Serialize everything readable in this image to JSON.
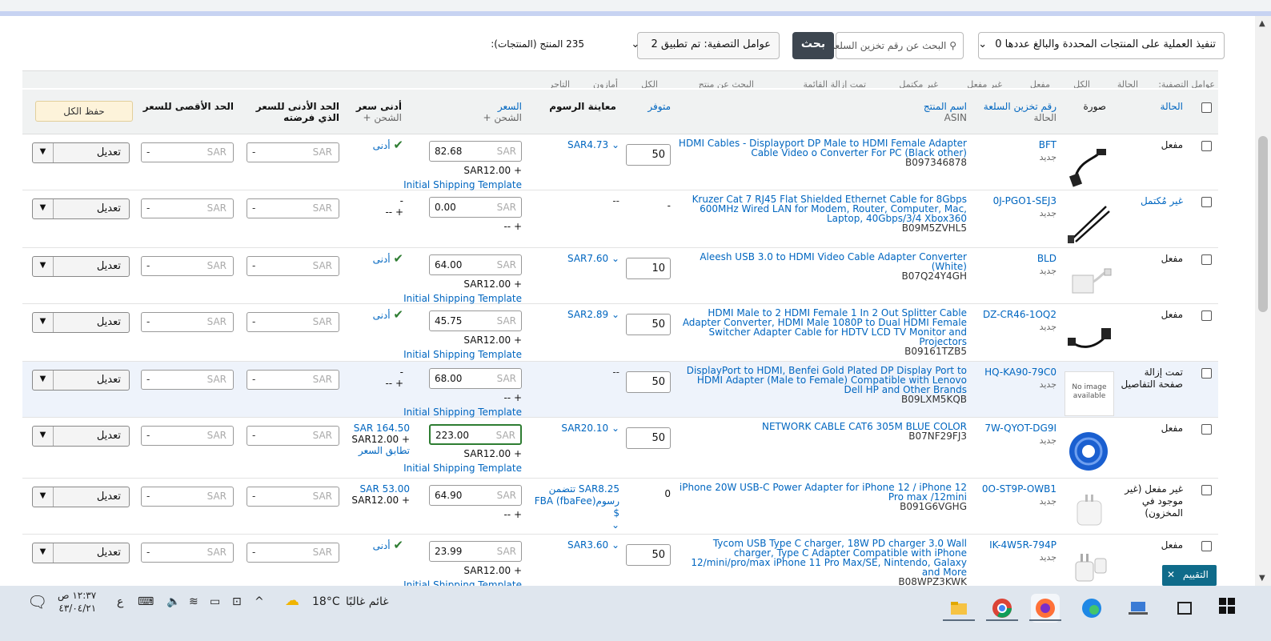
{
  "toolbar": {
    "bulk_action": "تنفيذ العملية على المنتجات المحددة والبالغ عددها 0",
    "search_placeholder": "البحث عن رقم تخزين السلعة أو رقم",
    "search_button": "بحث",
    "filter_label": "عوامل التصفية: تم تطبيق 2",
    "product_count": "235 المنتج (المنتجات):"
  },
  "filterbar": {
    "label": "عوامل التصفية:",
    "options": [
      "الحالة",
      "الكل",
      "مفعل",
      "غير مفعل",
      "غير مكتمل",
      "تمت إزالة القائمة",
      "البحث عن منتج",
      "الكل",
      "أمازون",
      "التاجر"
    ]
  },
  "columns": {
    "status": "الحالة",
    "image": "صورة",
    "sku": "رقم تخزين السلعة",
    "sku_sub": "الحالة",
    "name": "اسم المنتج",
    "name_sub": "ASIN",
    "available": "متوفر",
    "fees": "معاينة الرسوم",
    "price": "السعر",
    "price_sub": "+ الشحن",
    "lowest": "أدنى سعر",
    "lowest_sub": "+ الشحن",
    "min_price": "الحد الأدنى للسعر الذي فرضته",
    "max_price": "الحد الأقصى للسعر",
    "save_all": "حفظ الكل"
  },
  "common": {
    "currency": "SAR",
    "edit": "تعديل",
    "shipping_template": "Initial Shipping Template",
    "lowest_label": "أدنى",
    "dash": "-",
    "condition_new": "جديد",
    "plus_dash": "-- +"
  },
  "rows": [
    {
      "status": "مفعل",
      "sku": "BFT",
      "title": "HDMI Cables - Displayport DP Male to HDMI Female Adapter Cable Video o Converter For PC (Black other)",
      "asin": "B097346878",
      "qty": "50",
      "fee": "SAR4.73",
      "price": "82.68",
      "shipping": "SAR12.00 +",
      "template": true,
      "lowest": "check"
    },
    {
      "status": "غير مُكتمل",
      "status_link": true,
      "sku": "0J-PGO1-SEJ3",
      "title": "Kruzer Cat 7 RJ45 Flat Shielded Ethernet Cable for 8Gbps 600MHz Wired LAN for Modem, Router, Computer, Mac, Laptop, 40Gbps/3/4 Xbox360",
      "asin": "B09M5ZVHL5",
      "qty_plain": "-",
      "fee": "--",
      "price": "0.00",
      "shipping": "-- +",
      "template": false,
      "lowest": "dash"
    },
    {
      "status": "مفعل",
      "sku": "BLD",
      "title": "Aleesh USB 3.0 to HDMI Video Cable Adapter Converter (White)",
      "asin": "B07Q24Y4GH",
      "qty": "10",
      "fee": "SAR7.60",
      "price": "64.00",
      "shipping": "SAR12.00 +",
      "template": true,
      "lowest": "check"
    },
    {
      "status": "مفعل",
      "sku": "DZ-CR46-1OQ2",
      "title": "HDMI Male to 2 HDMI Female 1 In 2 Out Splitter Cable Adapter Converter, HDMI Male 1080P to Dual HDMI Female Switcher Adapter Cable for HDTV LCD TV Monitor and Projectors",
      "asin": "B09161TZB5",
      "qty": "50",
      "fee": "SAR2.89",
      "price": "45.75",
      "shipping": "SAR12.00 +",
      "template": true,
      "lowest": "check"
    },
    {
      "status": "تمت إزالة صفحة التفاصيل",
      "sku": "HQ-KA90-79C0",
      "title": "DisplayPort to HDMI, Benfei Gold Plated DP Display Port to HDMI Adapter (Male to Female) Compatible with Lenovo Dell HP and Other Brands",
      "asin": "B09LXM5KQB",
      "qty": "50",
      "fee": "--",
      "price": "68.00",
      "shipping": "-- +",
      "template": true,
      "lowest": "dash",
      "no_image": "No image available"
    },
    {
      "status": "مفعل",
      "sku": "7W-QYOT-DG9I",
      "title": "NETWORK CABLE CAT6 305M BLUE COLOR",
      "asin": "B07NF29FJ3",
      "qty": "50",
      "fee": "SAR20.10",
      "price": "223.00",
      "shipping": "SAR12.00 +",
      "template": true,
      "lowest": "price",
      "lowest_price": "SAR 164.50",
      "lowest_ship": "SAR12.00 +",
      "match": "تطابق السعر"
    },
    {
      "status": "غير مفعل (غير موجود في المخزون)",
      "sku": "0O-ST9P-OWB1",
      "title": "iPhone 20W USB-C Power Adapter for iPhone 12 / iPhone 12 Pro max /12mini",
      "asin": "B091G6VGHG",
      "qty_plain": "0",
      "fee": "SAR8.25 تتضمن رسوم(fbaFee) FBA $",
      "price": "64.90",
      "shipping": "-- +",
      "template": false,
      "lowest": "price2",
      "lowest_price": "SAR 53.00",
      "lowest_ship": "SAR12.00 +"
    },
    {
      "status": "مفعل",
      "sku": "IK-4W5R-794P",
      "title": "Tycom USB Type C charger, 18W PD charger 3.0 Wall charger, Type C Adapter Compatible with iPhone 12/mini/pro/max iPhone 11 Pro Max/SE, Nintendo, Galaxy and More",
      "asin": "B08WPZ3KWK",
      "qty": "50",
      "fee": "SAR3.60",
      "price": "23.99",
      "shipping": "SAR12.00 +",
      "template": true,
      "lowest": "check"
    }
  ],
  "rating_popup": "التقييم",
  "taskbar": {
    "time": "١٢:٣٧ ص",
    "date": "٤٣/٠٤/٢١",
    "lang": "ع",
    "temperature": "18°C",
    "weather": "غائم غالبًا"
  }
}
